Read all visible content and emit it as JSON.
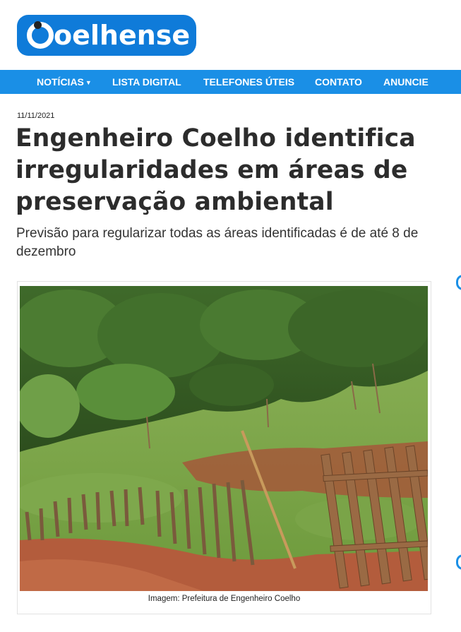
{
  "site": {
    "logo_text": "oelhense",
    "logo_alt": "Coelhense"
  },
  "nav": {
    "items": [
      {
        "label": "NOTÍCIAS"
      },
      {
        "label": "LISTA DIGITAL"
      },
      {
        "label": "TELEFONES ÚTEIS"
      },
      {
        "label": "CONTATO"
      },
      {
        "label": "ANUNCIE"
      }
    ]
  },
  "article": {
    "date": "11/11/2021",
    "headline": "Engenheiro Coelho identifica irregularidades em áreas de preservação ambiental",
    "subtitle": "Previsão para regularizar todas as áreas identificadas é de até 8 de dezembro",
    "image_caption": "Imagem: Prefeitura de Engenheiro Coelho"
  },
  "colors": {
    "brand_blue": "#0f7bd9",
    "nav_blue": "#1a8fe6"
  },
  "icons": {
    "nav_dropdown": "caret-down-icon"
  }
}
